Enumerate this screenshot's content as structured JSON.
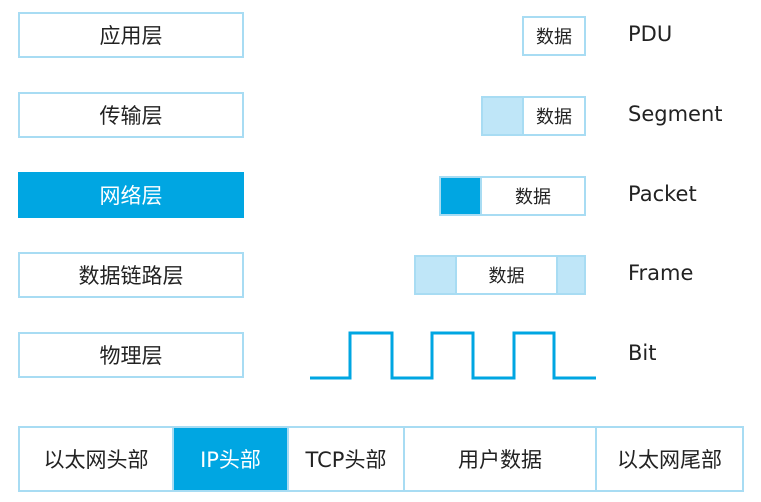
{
  "layers": [
    {
      "label": "应用层",
      "pdu_label": "PDU",
      "data_label": "数据",
      "active": false
    },
    {
      "label": "传输层",
      "pdu_label": "Segment",
      "data_label": "数据",
      "active": false
    },
    {
      "label": "网络层",
      "pdu_label": "Packet",
      "data_label": "数据",
      "active": true
    },
    {
      "label": "数据链路层",
      "pdu_label": "Frame",
      "data_label": "数据",
      "active": false
    },
    {
      "label": "物理层",
      "pdu_label": "Bit",
      "active": false
    }
  ],
  "header_fields": [
    "以太网头部",
    "IP头部",
    "TCP头部",
    "用户数据",
    "以太网尾部"
  ],
  "active_header_field": "IP头部",
  "colors": {
    "accent": "#00a6e2",
    "light": "#bfe6f8",
    "border": "#a8dcf3"
  }
}
